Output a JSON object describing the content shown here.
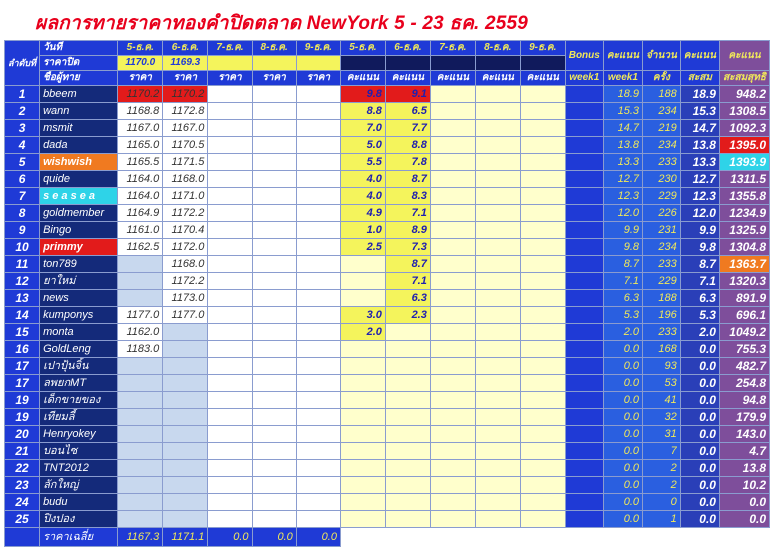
{
  "title": "ผลการทายราคาทองคำปิดตลาด NewYork 5 - 23 ธค. 2559",
  "header": {
    "rank_label": "ลำดับที่",
    "date_label": "วันที่",
    "close_label": "ราคาปิด",
    "name_label": "ชื่อผู้ทาย",
    "dates": [
      "5-ธ.ค.",
      "6-ธ.ค.",
      "7-ธ.ค.",
      "8-ธ.ค.",
      "9-ธ.ค."
    ],
    "score_dates": [
      "5-ธ.ค.",
      "6-ธ.ค.",
      "7-ธ.ค.",
      "8-ธ.ค.",
      "9-ธ.ค."
    ],
    "close_prices": [
      "1170.0",
      "1169.3",
      "",
      "",
      ""
    ],
    "price_label": "ราคา",
    "score_label": "คะแนน",
    "bonus_label": "Bonus",
    "week1_label": "week1",
    "score_week1_a": "คะแนน",
    "score_week1_b": "week1",
    "count_a": "จำนวน",
    "count_b": "ครั้ง",
    "cum_a": "คะแนน",
    "cum_b": "สะสม",
    "net_a": "คะแนน",
    "net_b": "สะสมสุทธิ"
  },
  "rows": [
    {
      "rank": "1",
      "name": "bbeem",
      "p": [
        "1170.2",
        "1170.2",
        "",
        "",
        ""
      ],
      "s": [
        "9.8",
        "9.1",
        "",
        "",
        ""
      ],
      "w": "18.9",
      "c": "188",
      "cum": "18.9",
      "net": "948.2",
      "hl": "red"
    },
    {
      "rank": "2",
      "name": "wann",
      "p": [
        "1168.8",
        "1172.8",
        "",
        "",
        ""
      ],
      "s": [
        "8.8",
        "6.5",
        "",
        "",
        ""
      ],
      "w": "15.3",
      "c": "234",
      "cum": "15.3",
      "net": "1308.5"
    },
    {
      "rank": "3",
      "name": "msmit",
      "p": [
        "1167.0",
        "1167.0",
        "",
        "",
        ""
      ],
      "s": [
        "7.0",
        "7.7",
        "",
        "",
        ""
      ],
      "w": "14.7",
      "c": "219",
      "cum": "14.7",
      "net": "1092.3"
    },
    {
      "rank": "4",
      "name": "dada",
      "p": [
        "1165.0",
        "1170.5",
        "",
        "",
        ""
      ],
      "s": [
        "5.0",
        "8.8",
        "",
        "",
        ""
      ],
      "w": "13.8",
      "c": "234",
      "cum": "13.8",
      "net": "1395.0",
      "nethl": "red"
    },
    {
      "rank": "5",
      "name": "wishwish",
      "p": [
        "1165.5",
        "1171.5",
        "",
        "",
        ""
      ],
      "s": [
        "5.5",
        "7.8",
        "",
        "",
        ""
      ],
      "w": "13.3",
      "c": "233",
      "cum": "13.3",
      "net": "1393.9",
      "namehl": "orange",
      "nethl": "cyan"
    },
    {
      "rank": "6",
      "name": "quide",
      "p": [
        "1164.0",
        "1168.0",
        "",
        "",
        ""
      ],
      "s": [
        "4.0",
        "8.7",
        "",
        "",
        ""
      ],
      "w": "12.7",
      "c": "230",
      "cum": "12.7",
      "net": "1311.5"
    },
    {
      "rank": "7",
      "name": "s e a s e a",
      "p": [
        "1164.0",
        "1171.0",
        "",
        "",
        ""
      ],
      "s": [
        "4.0",
        "8.3",
        "",
        "",
        ""
      ],
      "w": "12.3",
      "c": "229",
      "cum": "12.3",
      "net": "1355.8",
      "namehl": "cyan"
    },
    {
      "rank": "8",
      "name": "goldmember",
      "p": [
        "1164.9",
        "1172.2",
        "",
        "",
        ""
      ],
      "s": [
        "4.9",
        "7.1",
        "",
        "",
        ""
      ],
      "w": "12.0",
      "c": "226",
      "cum": "12.0",
      "net": "1234.9"
    },
    {
      "rank": "9",
      "name": "Bingo",
      "p": [
        "1161.0",
        "1170.4",
        "",
        "",
        ""
      ],
      "s": [
        "1.0",
        "8.9",
        "",
        "",
        ""
      ],
      "w": "9.9",
      "c": "231",
      "cum": "9.9",
      "net": "1325.9"
    },
    {
      "rank": "10",
      "name": "primmy",
      "p": [
        "1162.5",
        "1172.0",
        "",
        "",
        ""
      ],
      "s": [
        "2.5",
        "7.3",
        "",
        "",
        ""
      ],
      "w": "9.8",
      "c": "234",
      "cum": "9.8",
      "net": "1304.8",
      "namehl": "red"
    },
    {
      "rank": "11",
      "name": "ton789",
      "p": [
        "",
        "1168.0",
        "",
        "",
        ""
      ],
      "s": [
        "",
        "8.7",
        "",
        "",
        ""
      ],
      "w": "8.7",
      "c": "233",
      "cum": "8.7",
      "net": "1363.7",
      "nethl": "orange"
    },
    {
      "rank": "12",
      "name": "ยาใหม่",
      "p": [
        "",
        "1172.2",
        "",
        "",
        ""
      ],
      "s": [
        "",
        "7.1",
        "",
        "",
        ""
      ],
      "w": "7.1",
      "c": "229",
      "cum": "7.1",
      "net": "1320.3"
    },
    {
      "rank": "13",
      "name": "news",
      "p": [
        "",
        "1173.0",
        "",
        "",
        ""
      ],
      "s": [
        "",
        "6.3",
        "",
        "",
        ""
      ],
      "w": "6.3",
      "c": "188",
      "cum": "6.3",
      "net": "891.9"
    },
    {
      "rank": "14",
      "name": "kumponys",
      "p": [
        "1177.0",
        "1177.0",
        "",
        "",
        ""
      ],
      "s": [
        "3.0",
        "2.3",
        "",
        "",
        ""
      ],
      "w": "5.3",
      "c": "196",
      "cum": "5.3",
      "net": "696.1"
    },
    {
      "rank": "15",
      "name": "monta",
      "p": [
        "1162.0",
        "",
        "",
        "",
        ""
      ],
      "s": [
        "2.0",
        "",
        "",
        "",
        ""
      ],
      "w": "2.0",
      "c": "233",
      "cum": "2.0",
      "net": "1049.2"
    },
    {
      "rank": "16",
      "name": "GoldLeng",
      "p": [
        "1183.0",
        "",
        "",
        "",
        ""
      ],
      "s": [
        "",
        "",
        "",
        "",
        ""
      ],
      "w": "0.0",
      "c": "168",
      "cum": "0.0",
      "net": "755.3"
    },
    {
      "rank": "17",
      "name": "เปาปุ้นจิ้น",
      "p": [
        "",
        "",
        "",
        "",
        ""
      ],
      "s": [
        "",
        "",
        "",
        "",
        ""
      ],
      "w": "0.0",
      "c": "93",
      "cum": "0.0",
      "net": "482.7"
    },
    {
      "rank": "17",
      "name": "ลพยกMT",
      "p": [
        "",
        "",
        "",
        "",
        ""
      ],
      "s": [
        "",
        "",
        "",
        "",
        ""
      ],
      "w": "0.0",
      "c": "53",
      "cum": "0.0",
      "net": "254.8"
    },
    {
      "rank": "19",
      "name": "เด็กขายของ",
      "p": [
        "",
        "",
        "",
        "",
        ""
      ],
      "s": [
        "",
        "",
        "",
        "",
        ""
      ],
      "w": "0.0",
      "c": "41",
      "cum": "0.0",
      "net": "94.8"
    },
    {
      "rank": "19",
      "name": "เทียมลี้",
      "p": [
        "",
        "",
        "",
        "",
        ""
      ],
      "s": [
        "",
        "",
        "",
        "",
        ""
      ],
      "w": "0.0",
      "c": "32",
      "cum": "0.0",
      "net": "179.9"
    },
    {
      "rank": "20",
      "name": "Henryokey",
      "p": [
        "",
        "",
        "",
        "",
        ""
      ],
      "s": [
        "",
        "",
        "",
        "",
        ""
      ],
      "w": "0.0",
      "c": "31",
      "cum": "0.0",
      "net": "143.0"
    },
    {
      "rank": "21",
      "name": "บอนไซ",
      "p": [
        "",
        "",
        "",
        "",
        ""
      ],
      "s": [
        "",
        "",
        "",
        "",
        ""
      ],
      "w": "0.0",
      "c": "7",
      "cum": "0.0",
      "net": "4.7"
    },
    {
      "rank": "22",
      "name": "TNT2012",
      "p": [
        "",
        "",
        "",
        "",
        ""
      ],
      "s": [
        "",
        "",
        "",
        "",
        ""
      ],
      "w": "0.0",
      "c": "2",
      "cum": "0.0",
      "net": "13.8"
    },
    {
      "rank": "23",
      "name": "ลักใหญ่",
      "p": [
        "",
        "",
        "",
        "",
        ""
      ],
      "s": [
        "",
        "",
        "",
        "",
        ""
      ],
      "w": "0.0",
      "c": "2",
      "cum": "0.0",
      "net": "10.2"
    },
    {
      "rank": "24",
      "name": "budu",
      "p": [
        "",
        "",
        "",
        "",
        ""
      ],
      "s": [
        "",
        "",
        "",
        "",
        ""
      ],
      "w": "0.0",
      "c": "0",
      "cum": "0.0",
      "net": "0.0"
    },
    {
      "rank": "25",
      "name": "ปิงปอง",
      "p": [
        "",
        "",
        "",
        "",
        ""
      ],
      "s": [
        "",
        "",
        "",
        "",
        ""
      ],
      "w": "0.0",
      "c": "1",
      "cum": "0.0",
      "net": "0.0"
    }
  ],
  "footer": {
    "label": "ราคาเฉลี่ย",
    "averages": [
      "1167.3",
      "1171.1",
      "0.0",
      "0.0",
      "0.0"
    ]
  }
}
